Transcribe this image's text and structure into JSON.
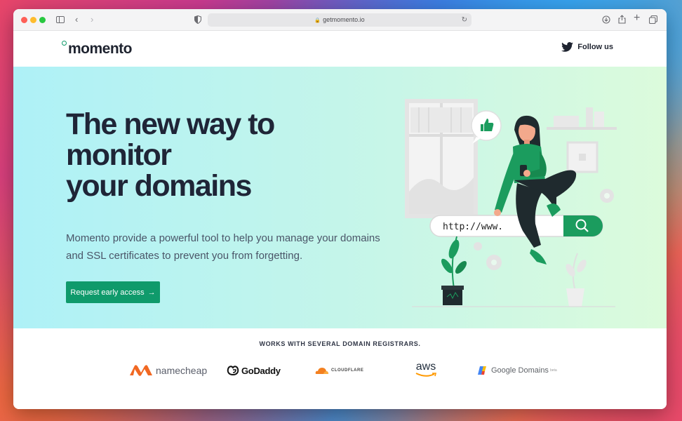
{
  "browser": {
    "url": "getmomento.io"
  },
  "header": {
    "logo": "momento",
    "follow_label": "Follow us"
  },
  "hero": {
    "title_line1": "The new way to",
    "title_line2": "monitor",
    "title_line3": "your domains",
    "description": "Momento provide a powerful tool to help you manage your domains and SSL certificates to prevent you from forgetting.",
    "cta_label": "Request early access",
    "cta_arrow": "→",
    "search_text": "http://www."
  },
  "registrars": {
    "title": "WORKS WITH SEVERAL DOMAIN REGISTRARS.",
    "items": [
      {
        "name": "namecheap"
      },
      {
        "name": "GoDaddy"
      },
      {
        "name": "CLOUDFLARE"
      },
      {
        "name": "aws"
      },
      {
        "name": "Google Domains",
        "suffix": "beta"
      }
    ]
  },
  "colors": {
    "accent": "#0f9a6b",
    "text_dark": "#1f2537",
    "hero_start": "#aef1f7",
    "hero_end": "#dcfbdc"
  }
}
